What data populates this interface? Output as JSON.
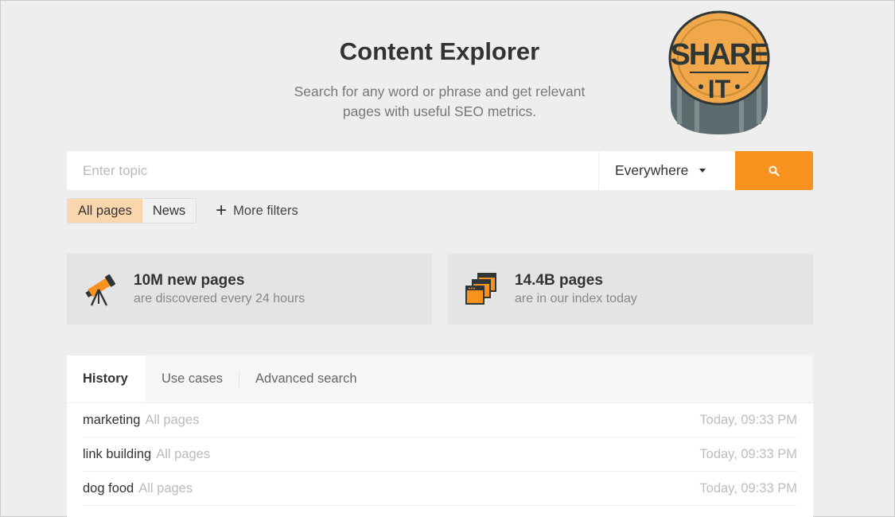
{
  "page": {
    "title": "Content Explorer",
    "subtitle_line1": "Search for any word or phrase and get relevant",
    "subtitle_line2": "pages with useful SEO metrics."
  },
  "badge": {
    "text_top": "SHARE",
    "text_bottom": "IT",
    "colors": {
      "face": "#f0a84a",
      "rim": "#5b6a6c",
      "ink": "#2f3637"
    }
  },
  "search": {
    "placeholder": "Enter topic",
    "value": "",
    "scope": "Everywhere",
    "button_icon": "search-icon",
    "button_color": "#f8911e"
  },
  "filters": {
    "segments": [
      {
        "label": "All pages",
        "active": true
      },
      {
        "label": "News",
        "active": false
      }
    ],
    "more_label": "More filters"
  },
  "stats": [
    {
      "icon": "telescope-icon",
      "title": "10M new pages",
      "subtitle": "are discovered every 24 hours"
    },
    {
      "icon": "pages-stack-icon",
      "title": "14.4B pages",
      "subtitle": "are in our index today"
    }
  ],
  "tabs": [
    {
      "label": "History",
      "active": true
    },
    {
      "label": "Use cases",
      "active": false
    },
    {
      "label": "Advanced search",
      "active": false
    }
  ],
  "history": [
    {
      "query": "marketing",
      "scope": "All pages",
      "time": "Today, 09:33 PM"
    },
    {
      "query": "link building",
      "scope": "All pages",
      "time": "Today, 09:33 PM"
    },
    {
      "query": "dog food",
      "scope": "All pages",
      "time": "Today, 09:33 PM"
    }
  ],
  "colors": {
    "accent": "#f8911e",
    "segment_active": "#fbd6ad",
    "background": "#eeeeef"
  }
}
